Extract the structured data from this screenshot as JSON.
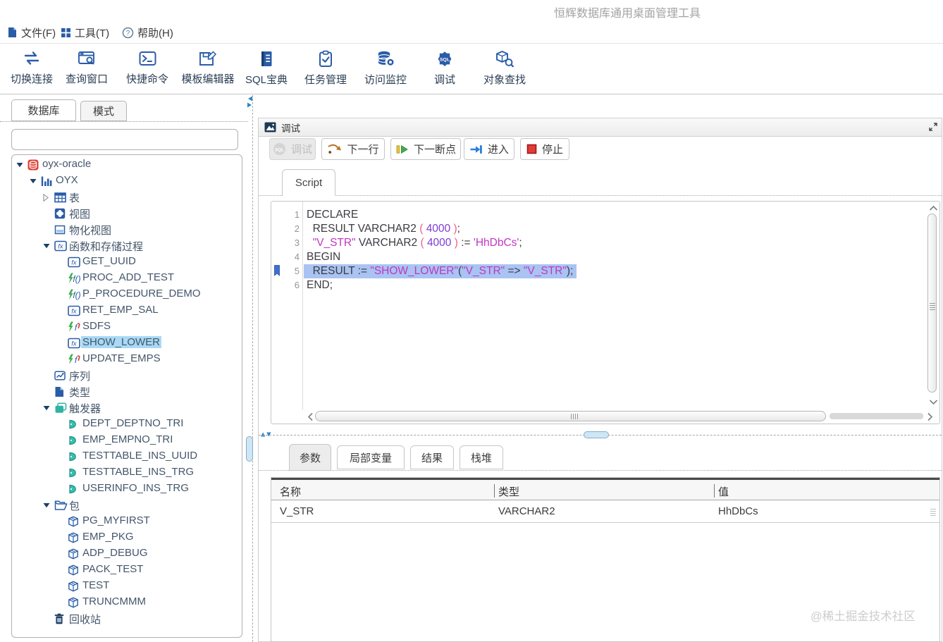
{
  "window": {
    "title": "恒辉数据库通用桌面管理工具",
    "watermark": "@稀土掘金技术社区"
  },
  "menubar": {
    "items": [
      {
        "label": "文件(F)",
        "icon": "file-icon"
      },
      {
        "label": "工具(T)",
        "icon": "tools-icon"
      },
      {
        "label": "帮助(H)",
        "icon": "help-icon"
      }
    ]
  },
  "toolbar": {
    "items": [
      {
        "label": "切换连接",
        "icon": "switch-connection-icon"
      },
      {
        "label": "查询窗口",
        "icon": "query-window-icon"
      },
      {
        "label": "快捷命令",
        "icon": "quick-command-icon"
      },
      {
        "label": "模板编辑器",
        "icon": "template-editor-icon"
      },
      {
        "label": "SQL宝典",
        "icon": "sql-book-icon"
      },
      {
        "label": "任务管理",
        "icon": "task-manager-icon"
      },
      {
        "label": "访问监控",
        "icon": "access-monitor-icon"
      },
      {
        "label": "调试",
        "icon": "debug-db-icon"
      },
      {
        "label": "对象查找",
        "icon": "object-search-icon"
      }
    ]
  },
  "sidebar": {
    "tabs": [
      {
        "label": "数据库",
        "active": true
      },
      {
        "label": "模式",
        "active": false
      }
    ],
    "search": {
      "value": ""
    },
    "tree": [
      {
        "label": "oyx-oracle",
        "level": 0,
        "arrow": "expanded",
        "icon": "database-red-icon",
        "selected": false
      },
      {
        "label": "OYX",
        "level": 1,
        "arrow": "expanded",
        "icon": "schema-icon",
        "selected": false
      },
      {
        "label": "表",
        "level": 2,
        "arrow": "collapsed",
        "icon": "table-icon",
        "selected": false
      },
      {
        "label": "视图",
        "level": 2,
        "arrow": null,
        "icon": "view-icon",
        "selected": false
      },
      {
        "label": "物化视图",
        "level": 2,
        "arrow": null,
        "icon": "materialized-view-icon",
        "selected": false
      },
      {
        "label": "函数和存储过程",
        "level": 2,
        "arrow": "expanded",
        "icon": "fx-box-icon",
        "selected": false
      },
      {
        "label": "GET_UUID",
        "level": 3,
        "arrow": null,
        "icon": "fx-box-icon",
        "selected": false
      },
      {
        "label": "PROC_ADD_TEST",
        "level": 3,
        "arrow": null,
        "icon": "function-green-icon",
        "selected": false
      },
      {
        "label": "P_PROCEDURE_DEMO",
        "level": 3,
        "arrow": null,
        "icon": "function-green-icon",
        "selected": false
      },
      {
        "label": "RET_EMP_SAL",
        "level": 3,
        "arrow": null,
        "icon": "fx-box-icon",
        "selected": false
      },
      {
        "label": "SDFS",
        "level": 3,
        "arrow": null,
        "icon": "function-green-red-icon",
        "selected": false
      },
      {
        "label": "SHOW_LOWER",
        "level": 3,
        "arrow": null,
        "icon": "fx-box-icon",
        "selected": true
      },
      {
        "label": "UPDATE_EMPS",
        "level": 3,
        "arrow": null,
        "icon": "function-green-red-icon",
        "selected": false
      },
      {
        "label": "序列",
        "level": 2,
        "arrow": null,
        "icon": "sequence-icon",
        "selected": false
      },
      {
        "label": "类型",
        "level": 2,
        "arrow": null,
        "icon": "type-icon",
        "selected": false
      },
      {
        "label": "触发器",
        "level": 2,
        "arrow": "expanded",
        "icon": "trigger-group-icon",
        "selected": false
      },
      {
        "label": "DEPT_DEPTNO_TRI",
        "level": 3,
        "arrow": null,
        "icon": "trigger-icon",
        "selected": false
      },
      {
        "label": "EMP_EMPNO_TRI",
        "level": 3,
        "arrow": null,
        "icon": "trigger-icon",
        "selected": false
      },
      {
        "label": "TESTTABLE_INS_UUID",
        "level": 3,
        "arrow": null,
        "icon": "trigger-icon",
        "selected": false
      },
      {
        "label": "TESTTABLE_INS_TRG",
        "level": 3,
        "arrow": null,
        "icon": "trigger-icon",
        "selected": false
      },
      {
        "label": "USERINFO_INS_TRG",
        "level": 3,
        "arrow": null,
        "icon": "trigger-icon",
        "selected": false
      },
      {
        "label": "包",
        "level": 2,
        "arrow": "expanded",
        "icon": "package-folder-icon",
        "selected": false
      },
      {
        "label": "PG_MYFIRST",
        "level": 3,
        "arrow": null,
        "icon": "package-icon",
        "selected": false
      },
      {
        "label": "EMP_PKG",
        "level": 3,
        "arrow": null,
        "icon": "package-icon",
        "selected": false
      },
      {
        "label": "ADP_DEBUG",
        "level": 3,
        "arrow": null,
        "icon": "package-icon",
        "selected": false
      },
      {
        "label": "PACK_TEST",
        "level": 3,
        "arrow": null,
        "icon": "package-icon",
        "selected": false
      },
      {
        "label": "TEST",
        "level": 3,
        "arrow": null,
        "icon": "package-icon",
        "selected": false
      },
      {
        "label": "TRUNCMMM",
        "level": 3,
        "arrow": null,
        "icon": "package-icon",
        "selected": false
      },
      {
        "label": "回收站",
        "level": 2,
        "arrow": null,
        "icon": "trash-icon",
        "selected": false
      }
    ]
  },
  "debug": {
    "window_title": "调试",
    "icon": "image-icon",
    "toolbar": [
      {
        "label": "调试",
        "icon": "sql-circle-icon",
        "disabled": true
      },
      {
        "label": "下一行",
        "icon": "step-line-icon",
        "disabled": false
      },
      {
        "label": "下一断点",
        "icon": "next-breakpoint-icon",
        "disabled": false
      },
      {
        "label": "进入",
        "icon": "step-into-icon",
        "disabled": false
      },
      {
        "label": "停止",
        "icon": "stop-icon",
        "disabled": false
      }
    ],
    "tab": "Script",
    "code": {
      "current_line": 5,
      "lines": [
        {
          "num": 1,
          "tokens": [
            [
              "DECLARE",
              "k"
            ]
          ]
        },
        {
          "num": 2,
          "tokens": [
            [
              "  RESULT VARCHAR2 ",
              "k"
            ],
            [
              "( ",
              "p"
            ],
            [
              "4000",
              "n"
            ],
            [
              " )",
              "p"
            ],
            [
              ";",
              "k"
            ]
          ]
        },
        {
          "num": 3,
          "tokens": [
            [
              "  ",
              "k"
            ],
            [
              "\"V_STR\"",
              "s"
            ],
            [
              " VARCHAR2 ",
              "k"
            ],
            [
              "( ",
              "p"
            ],
            [
              "4000",
              "n"
            ],
            [
              " ) ",
              "p"
            ],
            [
              ":= ",
              "k"
            ],
            [
              "'HhDbCs'",
              "s"
            ],
            [
              ";",
              "k"
            ]
          ]
        },
        {
          "num": 4,
          "tokens": [
            [
              "BEGIN",
              "k"
            ]
          ]
        },
        {
          "num": 5,
          "tokens": [
            [
              "  RESULT := ",
              "k"
            ],
            [
              "\"SHOW_LOWER\"",
              "s"
            ],
            [
              "(",
              "k"
            ],
            [
              "\"V_STR\"",
              "s"
            ],
            [
              " => ",
              "k"
            ],
            [
              "\"V_STR\"",
              "s"
            ],
            [
              ");",
              "k"
            ]
          ]
        },
        {
          "num": 6,
          "tokens": [
            [
              "END;",
              "k"
            ]
          ]
        }
      ]
    }
  },
  "bottom": {
    "tabs": [
      {
        "label": "参数",
        "active": true
      },
      {
        "label": "局部变量",
        "active": false
      },
      {
        "label": "结果",
        "active": false
      },
      {
        "label": "栈堆",
        "active": false
      }
    ],
    "table": {
      "headers": [
        "名称",
        "类型",
        "值"
      ],
      "rows": [
        [
          "V_STR",
          "VARCHAR2",
          "HhDbCs"
        ]
      ]
    }
  }
}
